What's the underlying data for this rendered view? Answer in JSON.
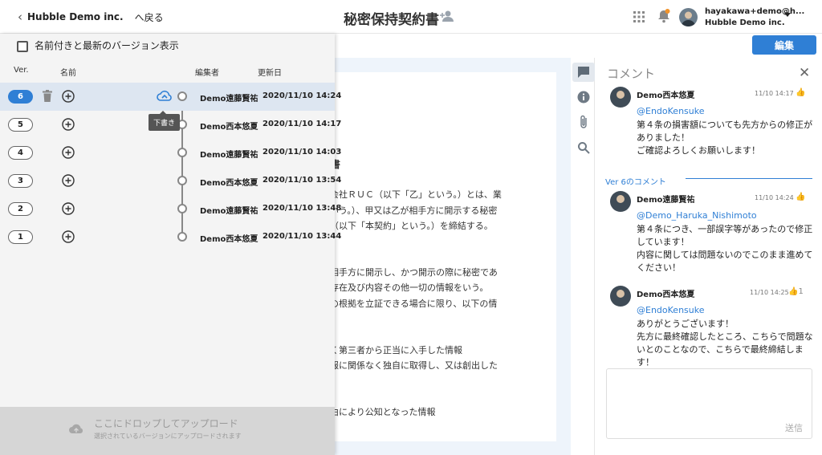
{
  "header": {
    "back_company": "Hubble Demo inc.",
    "back_label": "へ戻る",
    "title": "秘密保持契約書",
    "user_email": "hayakawa+demo@h...",
    "user_company": "Hubble Demo inc."
  },
  "edit_button": "編集",
  "document": {
    "lines": [
      "約書",
      "式会社ＲＵＣ（以下「乙」という。）とは、業",
      "という。）、甲又は乙が相手方に開示する秘密",
      "約（以下「本契約」という。）を締結する。",
      "が相手方に開示し、かつ開示の際に秘密であ",
      "の存在及び内容その他一切の情報をいう。",
      "その根拠を立証できる場合に限り、以下の情",
      "なく第三者から正当に入手した情報",
      "情報に関係なく独自に取得し、又は創出した",
      "事由により公知となった情報"
    ]
  },
  "version_panel": {
    "checkbox_label": "名前付きと最新のバージョン表示",
    "col_ver": "Ver.",
    "col_name": "名前",
    "col_editor": "編集者",
    "col_updated": "更新日",
    "tooltip": "下書き",
    "rows": [
      {
        "ver": "6",
        "editor": "Demo遠藤賢祐",
        "date": "2020/11/10 14:24"
      },
      {
        "ver": "5",
        "editor": "Demo西本悠夏",
        "date": "2020/11/10 14:17"
      },
      {
        "ver": "4",
        "editor": "Demo遠藤賢祐",
        "date": "2020/11/10 14:03"
      },
      {
        "ver": "3",
        "editor": "Demo西本悠夏",
        "date": "2020/11/10 13:54"
      },
      {
        "ver": "2",
        "editor": "Demo遠藤賢祐",
        "date": "2020/11/10 13:48"
      },
      {
        "ver": "1",
        "editor": "Demo西本悠夏",
        "date": "2020/11/10 13:44"
      }
    ],
    "drop_main": "ここにドロップしてアップロード",
    "drop_sub": "選択されているバージョンにアップロードされます"
  },
  "comments": {
    "title": "コメント",
    "version_divider": "Ver 6のコメント",
    "send_label": "送信",
    "items": [
      {
        "name": "Demo西本悠夏",
        "time": "11/10 14:17",
        "like": "",
        "mention": "@EndoKensuke",
        "body": "第４条の損害額についても先方からの修正がありました！\nご確認よろしくお願いします！"
      },
      {
        "name": "Demo遠藤賢祐",
        "time": "11/10 14:24",
        "like": "",
        "mention": "@Demo_Haruka_Nishimoto",
        "body": "第４条につき、一部誤字等があったので修正しています！\n内容に関しては問題ないのでこのまま進めてください！"
      },
      {
        "name": "Demo西本悠夏",
        "time": "11/10 14:25",
        "like": "1",
        "mention": "@EndoKensuke",
        "body": "ありがとうございます！\n先方に最終確認したところ、こちらで問題ないとのことなので、こちらで最終締結します！"
      }
    ]
  },
  "colors": {
    "accent": "#2f7fd5",
    "bell_dot": "#f0932b"
  }
}
